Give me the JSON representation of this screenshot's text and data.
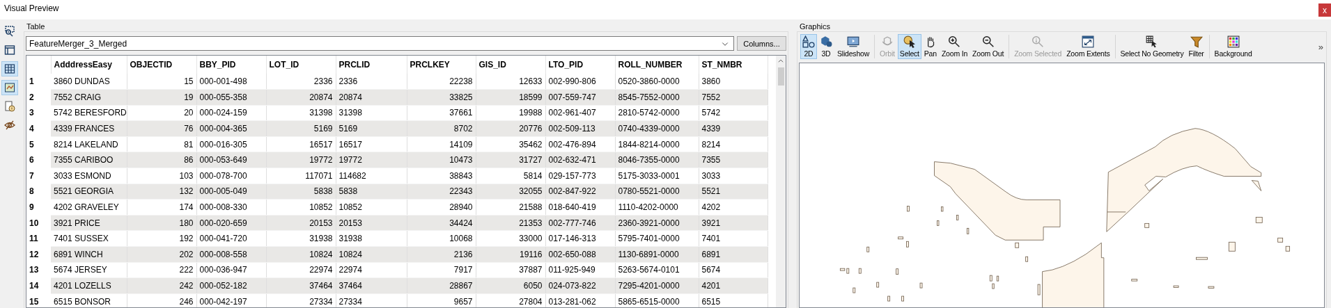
{
  "window": {
    "title": "Visual Preview",
    "close": "x"
  },
  "left_toolbar": [
    {
      "kind": "inspect",
      "selected": false
    },
    {
      "kind": "panel",
      "selected": false
    },
    {
      "kind": "grid",
      "selected": true
    },
    {
      "kind": "map",
      "selected": true
    },
    {
      "kind": "info",
      "selected": false
    },
    {
      "kind": "eye",
      "selected": false
    }
  ],
  "table": {
    "label": "Table",
    "dataset": "FeatureMerger_3_Merged",
    "columns_button": "Columns...",
    "columns": [
      {
        "label": "AdddressEasy",
        "numeric": false
      },
      {
        "label": "OBJECTID",
        "numeric": true
      },
      {
        "label": "BBY_PID",
        "numeric": false
      },
      {
        "label": "LOT_ID",
        "numeric": true
      },
      {
        "label": "PRCLID",
        "numeric": false
      },
      {
        "label": "PRCLKEY",
        "numeric": true
      },
      {
        "label": "GIS_ID",
        "numeric": true
      },
      {
        "label": "LTO_PID",
        "numeric": false
      },
      {
        "label": "ROLL_NUMBER",
        "numeric": false
      },
      {
        "label": "ST_NMBR",
        "numeric": false
      }
    ],
    "rows": [
      {
        "number": "1",
        "cells": [
          "3860 DUNDAS",
          "15",
          "000-001-498",
          "2336",
          "2336",
          "22238",
          "12633",
          "002-990-806",
          "0520-3860-0000",
          "3860"
        ]
      },
      {
        "number": "2",
        "cells": [
          "7552 CRAIG",
          "19",
          "000-055-358",
          "20874",
          "20874",
          "33825",
          "18599",
          "007-559-747",
          "8545-7552-0000",
          "7552"
        ]
      },
      {
        "number": "3",
        "cells": [
          "5742 BERESFORD",
          "20",
          "000-024-159",
          "31398",
          "31398",
          "37661",
          "19988",
          "002-961-407",
          "2810-5742-0000",
          "5742"
        ]
      },
      {
        "number": "4",
        "cells": [
          "4339 FRANCES",
          "76",
          "000-004-365",
          "5169",
          "5169",
          "8702",
          "20776",
          "002-509-113",
          "0740-4339-0000",
          "4339"
        ]
      },
      {
        "number": "5",
        "cells": [
          "8214 LAKELAND",
          "81",
          "000-016-305",
          "16517",
          "16517",
          "14109",
          "35462",
          "002-476-894",
          "1844-8214-0000",
          "8214"
        ]
      },
      {
        "number": "6",
        "cells": [
          "7355 CARIBOO",
          "86",
          "000-053-649",
          "19772",
          "19772",
          "10473",
          "31727",
          "002-632-471",
          "8046-7355-0000",
          "7355"
        ]
      },
      {
        "number": "7",
        "cells": [
          "3033 ESMOND",
          "103",
          "000-078-700",
          "117071",
          "114682",
          "38843",
          "5814",
          "029-157-773",
          "5175-3033-0001",
          "3033"
        ]
      },
      {
        "number": "8",
        "cells": [
          "5521 GEORGIA",
          "132",
          "000-005-049",
          "5838",
          "5838",
          "22343",
          "32055",
          "002-847-922",
          "0780-5521-0000",
          "5521"
        ]
      },
      {
        "number": "9",
        "cells": [
          "4202 GRAVELEY",
          "174",
          "000-008-330",
          "10852",
          "10852",
          "28940",
          "21588",
          "018-640-419",
          "1110-4202-0000",
          "4202"
        ]
      },
      {
        "number": "10",
        "cells": [
          "3921 PRICE",
          "180",
          "000-020-659",
          "20153",
          "20153",
          "34424",
          "21353",
          "002-777-746",
          "2360-3921-0000",
          "3921"
        ]
      },
      {
        "number": "11",
        "cells": [
          "7401 SUSSEX",
          "192",
          "000-041-720",
          "31938",
          "31938",
          "10068",
          "33000",
          "017-146-313",
          "5795-7401-0000",
          "7401"
        ]
      },
      {
        "number": "12",
        "cells": [
          "6891 WINCH",
          "202",
          "000-008-558",
          "10824",
          "10824",
          "2136",
          "19116",
          "002-650-088",
          "1130-6891-0000",
          "6891"
        ]
      },
      {
        "number": "13",
        "cells": [
          "5674 JERSEY",
          "222",
          "000-036-947",
          "22974",
          "22974",
          "7917",
          "37887",
          "011-925-949",
          "5263-5674-0101",
          "5674"
        ]
      },
      {
        "number": "14",
        "cells": [
          "4201 LOZELLS",
          "242",
          "000-052-182",
          "37464",
          "37464",
          "28867",
          "6050",
          "024-073-822",
          "7295-4201-0000",
          "4201"
        ]
      },
      {
        "number": "15",
        "cells": [
          "6515 BONSOR",
          "246",
          "000-042-197",
          "27334",
          "27334",
          "9657",
          "27804",
          "013-281-062",
          "5865-6515-0000",
          "6515"
        ]
      }
    ]
  },
  "graphics": {
    "label": "Graphics",
    "overflow": "»",
    "groups": [
      [
        {
          "kind": "flat",
          "label": "2D",
          "selected": true,
          "disabled": false
        },
        {
          "kind": "solid",
          "label": "3D",
          "selected": false,
          "disabled": false
        },
        {
          "kind": "slideshow",
          "label": "Slideshow",
          "selected": false,
          "disabled": false
        }
      ],
      [
        {
          "kind": "orbit",
          "label": "Orbit",
          "selected": false,
          "disabled": true
        },
        {
          "kind": "select",
          "label": "Select",
          "selected": true,
          "disabled": false
        },
        {
          "kind": "pan",
          "label": "Pan",
          "selected": false,
          "disabled": false
        },
        {
          "kind": "zoomin",
          "label": "Zoom In",
          "selected": false,
          "disabled": false
        },
        {
          "kind": "zoomout",
          "label": "Zoom Out",
          "selected": false,
          "disabled": false
        }
      ],
      [
        {
          "kind": "zoomselected",
          "label": "Zoom Selected",
          "selected": false,
          "disabled": true
        },
        {
          "kind": "extents",
          "label": "Zoom Extents",
          "selected": false,
          "disabled": false
        }
      ],
      [
        {
          "kind": "nogeometry",
          "label": "Select No Geometry",
          "selected": false,
          "disabled": false
        },
        {
          "kind": "filter",
          "label": "Filter",
          "selected": false,
          "disabled": false
        }
      ],
      [
        {
          "kind": "background",
          "label": "Background",
          "selected": false,
          "disabled": false
        }
      ]
    ]
  }
}
